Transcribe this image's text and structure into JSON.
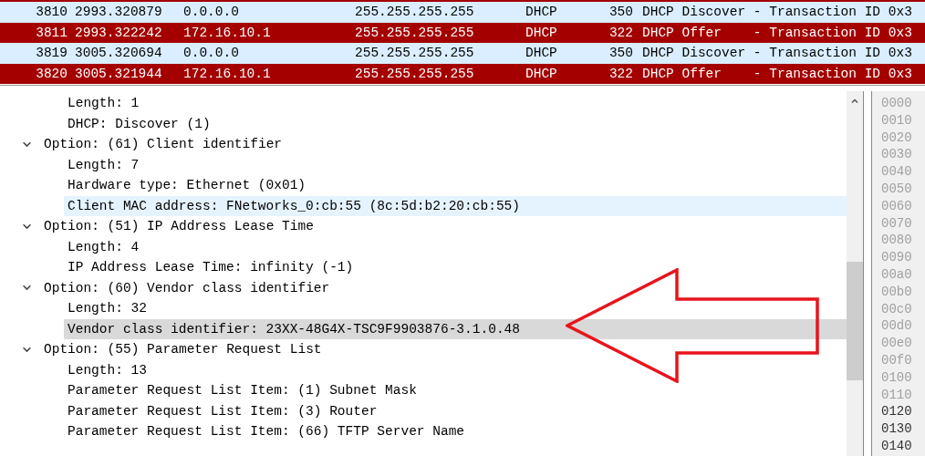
{
  "packet_list": {
    "rows": [
      {
        "no": "3810",
        "time": "2993.320879",
        "source": "0.0.0.0",
        "destination": "255.255.255.255",
        "protocol": "DHCP",
        "length": "350",
        "info": "DHCP Discover - Transaction ID 0x3",
        "color": "#daeeff"
      },
      {
        "no": "3811",
        "time": "2993.322242",
        "source": "172.16.10.1",
        "destination": "255.255.255.255",
        "protocol": "DHCP",
        "length": "322",
        "info": "DHCP Offer    - Transaction ID 0x3",
        "color": "#a40000"
      },
      {
        "no": "3819",
        "time": "3005.320694",
        "source": "0.0.0.0",
        "destination": "255.255.255.255",
        "protocol": "DHCP",
        "length": "350",
        "info": "DHCP Discover - Transaction ID 0x3",
        "color": "#daeeff"
      },
      {
        "no": "3820",
        "time": "3005.321944",
        "source": "172.16.10.1",
        "destination": "255.255.255.255",
        "protocol": "DHCP",
        "length": "322",
        "info": "DHCP Offer    - Transaction ID 0x3",
        "color": "#a40000"
      }
    ]
  },
  "details": {
    "continued_children": [
      {
        "label": "Length: 1",
        "selected": false,
        "hovered": false
      },
      {
        "label": "DHCP: Discover (1)",
        "selected": false,
        "hovered": false
      }
    ],
    "items": [
      {
        "label": "Option: (61) Client identifier",
        "expanded": true,
        "selected": false,
        "hovered": false,
        "children": [
          {
            "label": "Length: 7",
            "selected": false,
            "hovered": false
          },
          {
            "label": "Hardware type: Ethernet (0x01)",
            "selected": false,
            "hovered": false
          },
          {
            "label": "Client MAC address: FNetworks_0:cb:55 (8c:5d:b2:20:cb:55)",
            "selected": false,
            "hovered": true
          }
        ]
      },
      {
        "label": "Option: (51) IP Address Lease Time",
        "expanded": true,
        "selected": false,
        "hovered": false,
        "children": [
          {
            "label": "Length: 4",
            "selected": false,
            "hovered": false
          },
          {
            "label": "IP Address Lease Time: infinity (-1)",
            "selected": false,
            "hovered": false
          }
        ]
      },
      {
        "label": "Option: (60) Vendor class identifier",
        "expanded": true,
        "selected": false,
        "hovered": false,
        "children": [
          {
            "label": "Length: 32",
            "selected": false,
            "hovered": false
          },
          {
            "label": "Vendor class identifier: 23XX-48G4X-TSC9F9903876-3.1.0.48",
            "selected": true,
            "hovered": false
          }
        ]
      },
      {
        "label": "Option: (55) Parameter Request List",
        "expanded": true,
        "selected": false,
        "hovered": false,
        "children": [
          {
            "label": "Length: 13",
            "selected": false,
            "hovered": false
          },
          {
            "label": "Parameter Request List Item: (1) Subnet Mask",
            "selected": false,
            "hovered": false
          },
          {
            "label": "Parameter Request List Item: (3) Router",
            "selected": false,
            "hovered": false
          },
          {
            "label": "Parameter Request List Item: (66) TFTP Server Name",
            "selected": false,
            "hovered": false
          }
        ]
      }
    ]
  },
  "hex_offsets": [
    {
      "text": "0000",
      "highlighted": false
    },
    {
      "text": "0010",
      "highlighted": false
    },
    {
      "text": "0020",
      "highlighted": false
    },
    {
      "text": "0030",
      "highlighted": false
    },
    {
      "text": "0040",
      "highlighted": false
    },
    {
      "text": "0050",
      "highlighted": false
    },
    {
      "text": "0060",
      "highlighted": false
    },
    {
      "text": "0070",
      "highlighted": false
    },
    {
      "text": "0080",
      "highlighted": false
    },
    {
      "text": "0090",
      "highlighted": false
    },
    {
      "text": "00a0",
      "highlighted": false
    },
    {
      "text": "00b0",
      "highlighted": false
    },
    {
      "text": "00c0",
      "highlighted": false
    },
    {
      "text": "00d0",
      "highlighted": false
    },
    {
      "text": "00e0",
      "highlighted": false
    },
    {
      "text": "00f0",
      "highlighted": false
    },
    {
      "text": "0100",
      "highlighted": false
    },
    {
      "text": "0110",
      "highlighted": false
    },
    {
      "text": "0120",
      "highlighted": true
    },
    {
      "text": "0130",
      "highlighted": true
    },
    {
      "text": "0140",
      "highlighted": true
    }
  ]
}
